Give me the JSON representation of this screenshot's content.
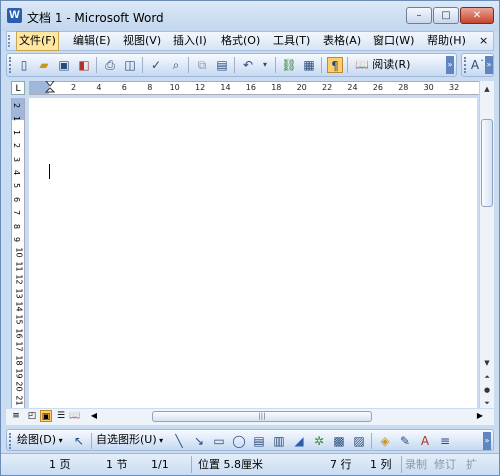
{
  "titlebar": {
    "title": "文档 1 - Microsoft Word",
    "minimize": "–",
    "maximize": "□",
    "close": "✕"
  },
  "menu": {
    "items": [
      {
        "label": "文件(F)"
      },
      {
        "label": "编辑(E)"
      },
      {
        "label": "视图(V)"
      },
      {
        "label": "插入(I)"
      },
      {
        "label": "格式(O)"
      },
      {
        "label": "工具(T)"
      },
      {
        "label": "表格(A)"
      },
      {
        "label": "窗口(W)"
      },
      {
        "label": "帮助(H)"
      }
    ],
    "close_glyph": "×"
  },
  "toolbar": {
    "read_label": "阅读(R)",
    "font_size_glyph": "A˙"
  },
  "ruler": {
    "corner": "L",
    "h_numbers": [
      "2",
      "4",
      "6",
      "8",
      "10",
      "12",
      "14",
      "16",
      "18",
      "20",
      "22",
      "24",
      "26",
      "28",
      "30",
      "32"
    ],
    "v_numbers": [
      "2",
      "1",
      "1",
      "2",
      "3",
      "4",
      "5",
      "6",
      "7",
      "8",
      "9",
      "10",
      "11",
      "12",
      "13",
      "14",
      "15",
      "16",
      "17",
      "18",
      "19",
      "20",
      "21"
    ]
  },
  "drawing_toolbar": {
    "draw_label": "绘图(D)",
    "autoshapes_label": "自选图形(U)"
  },
  "status": {
    "page": "1 页",
    "section": "1 节",
    "page_of": "1/1",
    "position": "位置 5.8厘米",
    "line": "7 行",
    "column": "1 列",
    "rec": "录制",
    "trk": "修订",
    "ext": "扩"
  },
  "colors": {
    "window_frame": "#c9dcf2",
    "menu_active": "#ffe7a2",
    "toolbar_active": "#ffcf6b",
    "ruler_margin": "#9eb7db"
  }
}
